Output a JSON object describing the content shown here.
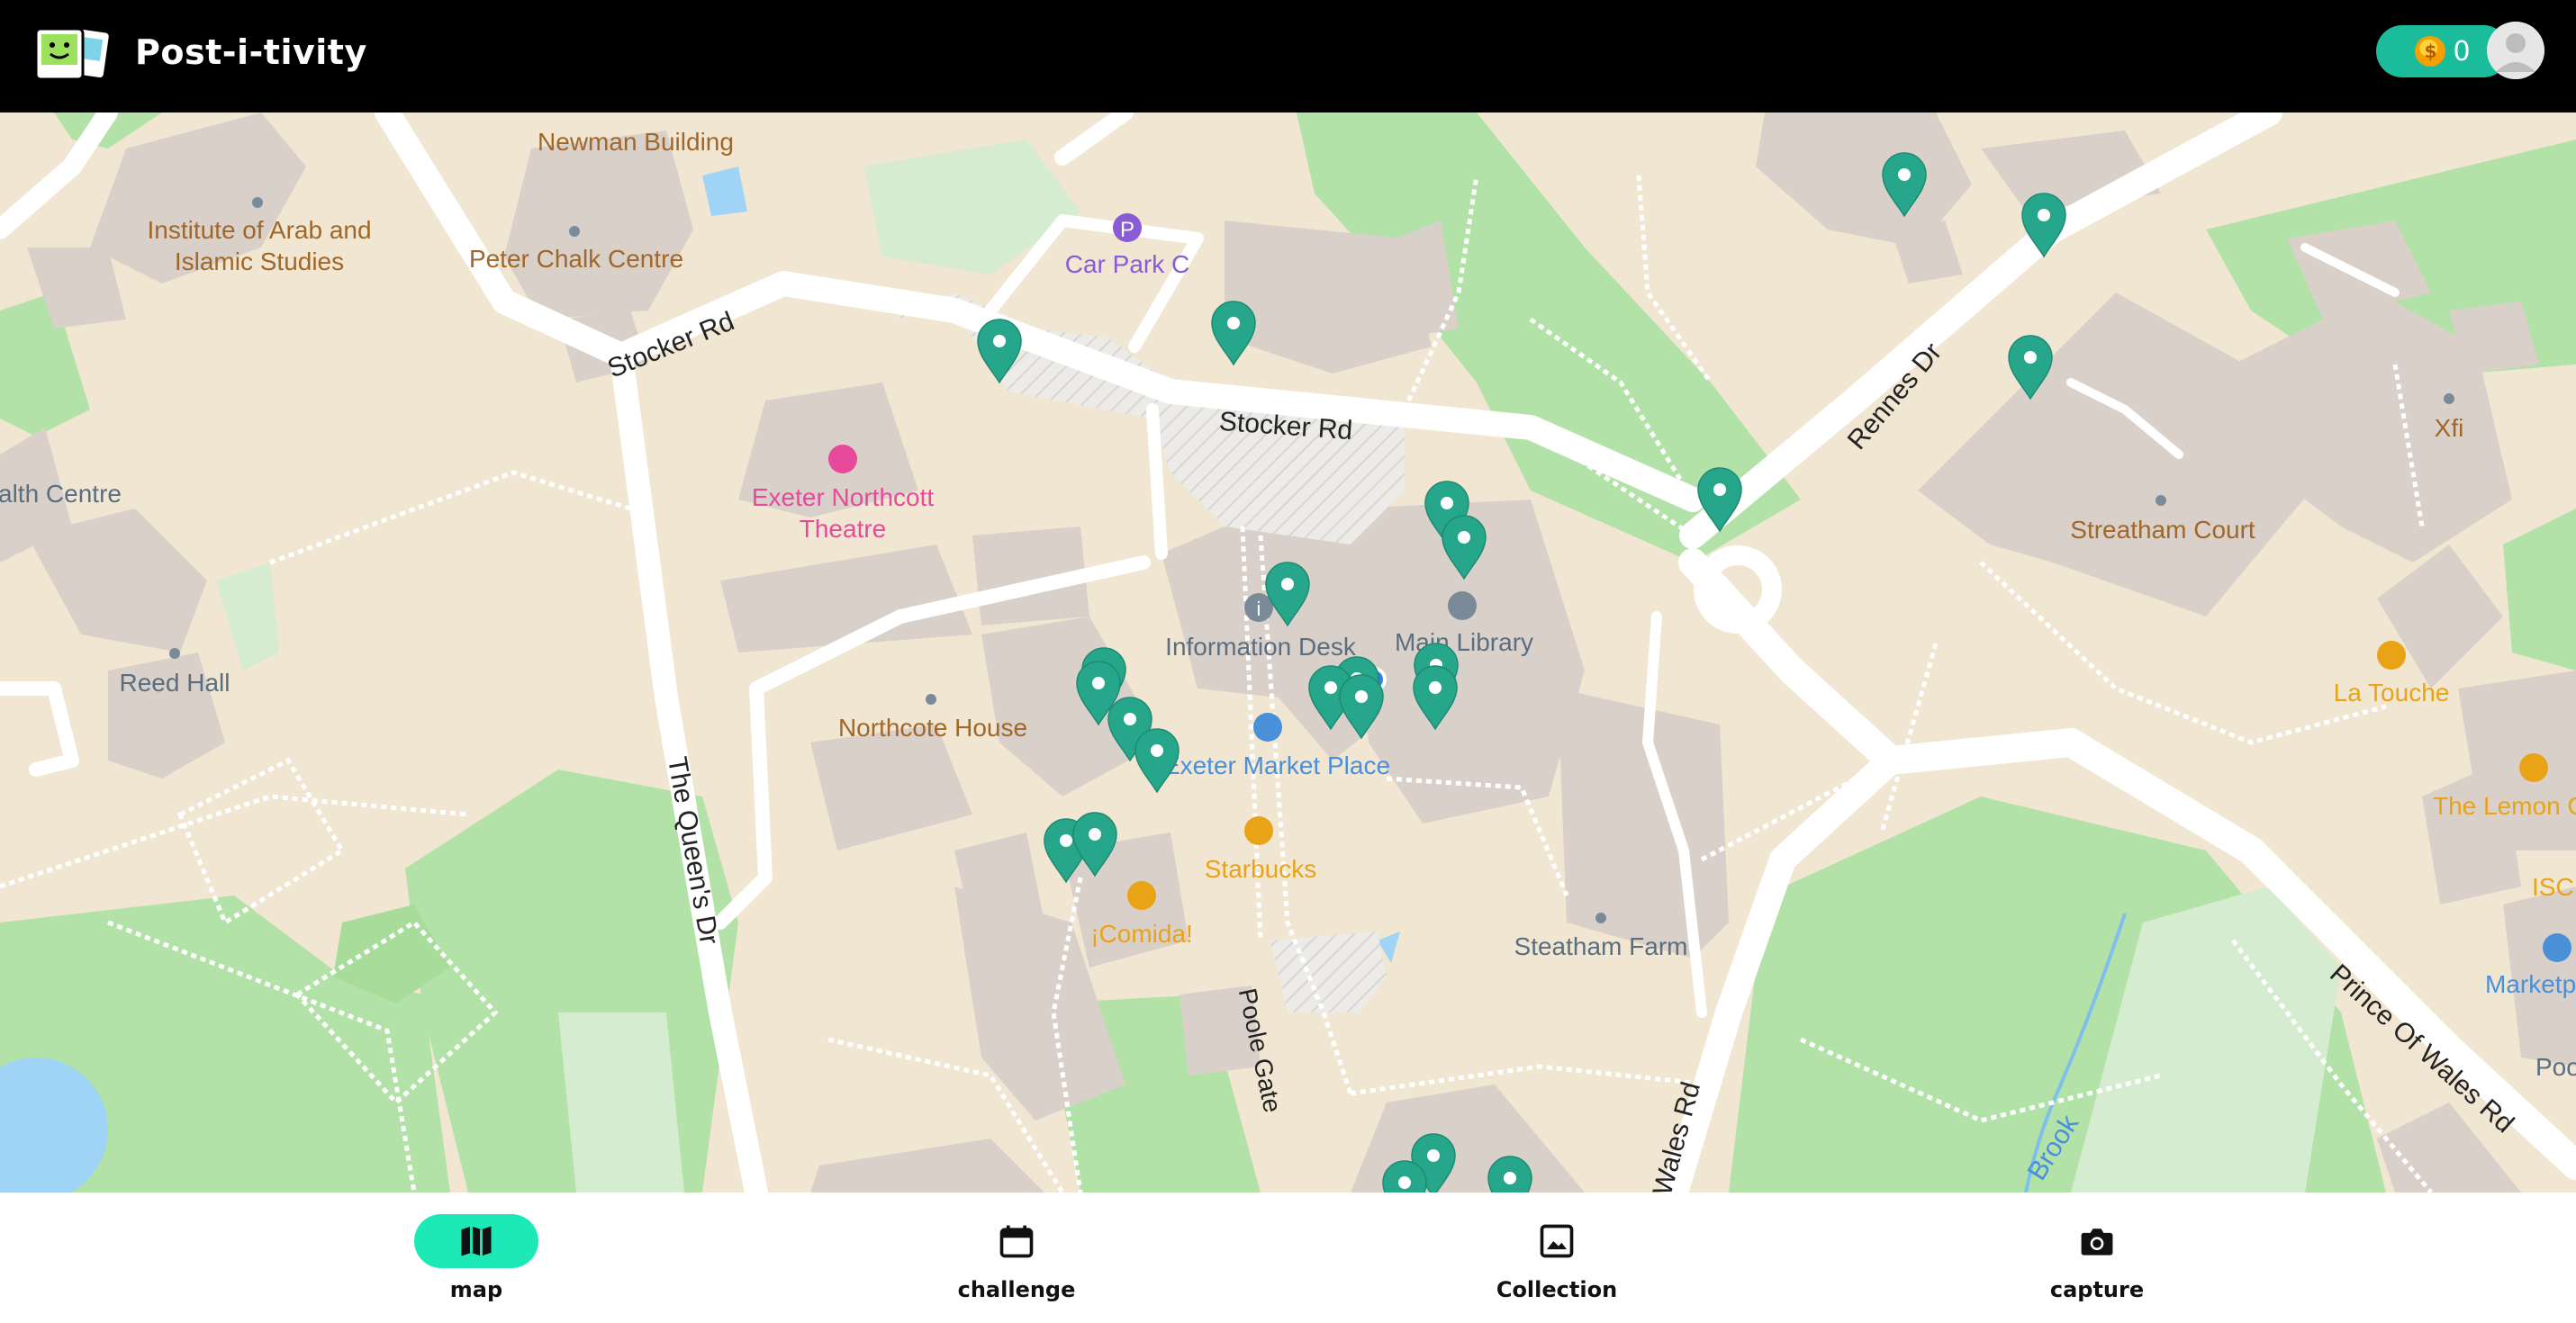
{
  "header": {
    "app_title": "Post-i-tivity",
    "coin_count": "0",
    "logo_icon": "postcard-smiley-logo",
    "avatar_icon": "user-avatar"
  },
  "map": {
    "labels": {
      "newman_building": "Newman Building",
      "institute_arab_1": "Institute of Arab and",
      "institute_arab_2": "Islamic Studies",
      "peter_chalk": "Peter Chalk Centre",
      "car_park": "Car Park C",
      "stocker_rd_1": "Stocker Rd",
      "stocker_rd_2": "Stocker Rd",
      "health_centre": "alth Centre",
      "exeter_northcott_1": "Exeter Northcott",
      "exeter_northcott_2": "Theatre",
      "information_desk": "Information Desk",
      "main_library": "Main Library",
      "reed_hall": "Reed Hall",
      "northcote_house": "Northcote House",
      "exeter_market_place": "Exeter Market Place",
      "starbucks": "Starbucks",
      "comida": "¡Comida!",
      "steatham_farm": "Steatham Farm",
      "the_queens_dr": "The Queen's Dr",
      "poole_gate": "Poole Gate",
      "rennes_dr": "Rennes Dr",
      "xfi": "Xfi",
      "streatham_court": "Streatham Court",
      "la_touche": "La Touche",
      "the_lemon": "The Lemon G",
      "isc": "ISC",
      "marketp": "Marketp",
      "poo": "Poo",
      "prince_of_wales_rd": "Prince Of Wales Rd",
      "wales_rd": "Wales Rd",
      "brook": "Brook"
    },
    "colors": {
      "land": "#f0e6d2",
      "building": "#d9d0c9",
      "park": "#b3e2a8",
      "water": "#9fd4f7",
      "road": "#ffffff",
      "marker": "#26a68a",
      "poi_orange": "#e8a317",
      "poi_blue": "#4a90d9",
      "poi_pink": "#e84a9b",
      "poi_purple": "#8a5bd6"
    }
  },
  "bottom_nav": {
    "items": [
      {
        "label": "map",
        "icon": "map-icon",
        "active": true
      },
      {
        "label": "challenge",
        "icon": "calendar-icon",
        "active": false
      },
      {
        "label": "Collection",
        "icon": "image-icon",
        "active": false
      },
      {
        "label": "capture",
        "icon": "camera-icon",
        "active": false
      }
    ]
  }
}
